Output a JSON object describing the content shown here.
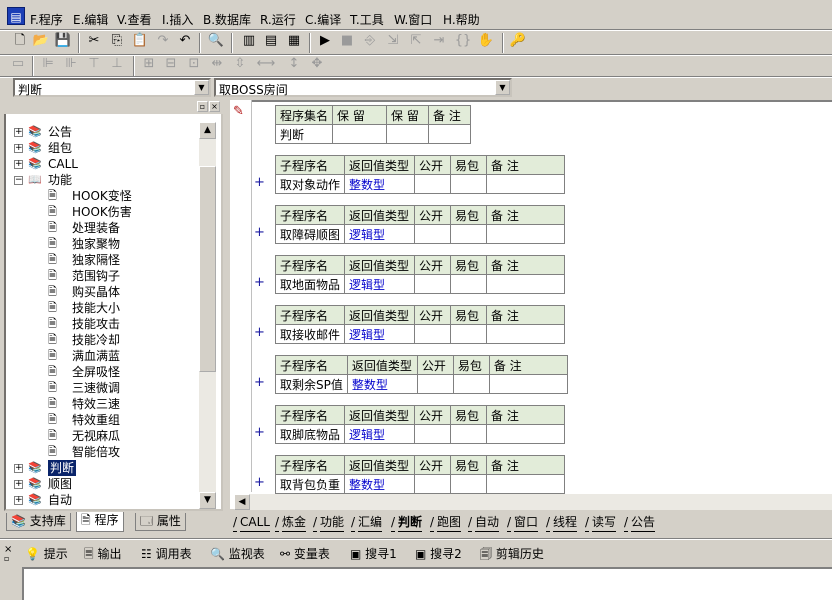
{
  "menu": [
    "F.程序",
    "E.编辑",
    "V.查看",
    "I.插入",
    "B.数据库",
    "R.运行",
    "C.编译",
    "T.工具",
    "W.窗口",
    "H.帮助"
  ],
  "icons": {
    "toolbar1": [
      "new-file-icon",
      "open-folder-icon",
      "save-icon",
      "cut-icon",
      "copy-icon",
      "paste-icon",
      "redo-icon",
      "undo-icon",
      "find-icon",
      "layout-icon",
      "layout2-icon",
      "layout3-icon",
      "run-icon",
      "stop-icon",
      "step-icons",
      "debug-icon"
    ],
    "toolbar2": [
      "align-icons"
    ]
  },
  "combos": {
    "left": "判断",
    "right": "取BOSS房间"
  },
  "tree": {
    "groups_before": [
      {
        "label": "公告",
        "expanded": false
      },
      {
        "label": "组包",
        "expanded": false
      },
      {
        "label": "CALL",
        "expanded": false
      },
      {
        "label": "功能",
        "expanded": true
      }
    ],
    "leaves": [
      "HOOK变怪",
      "HOOK伤害",
      "处理装备",
      "独家聚物",
      "独家隔怪",
      "范围钩子",
      "购买晶体",
      "技能大小",
      "技能攻击",
      "技能冷却",
      "满血满蓝",
      "全屏吸怪",
      "三速微调",
      "特效三速",
      "特效重组",
      "无视麻瓜",
      "智能倍攻"
    ],
    "groups_after": [
      {
        "label": "判断",
        "expanded": false,
        "selected": true
      },
      {
        "label": "顺图",
        "expanded": false
      },
      {
        "label": "自动",
        "expanded": false
      }
    ]
  },
  "left_tabs": [
    "支持库",
    "程序",
    "属性"
  ],
  "assembly": {
    "headers": [
      "程序集名",
      "保 留",
      "保 留",
      "备 注"
    ],
    "name": "判断"
  },
  "sub_headers": [
    "子程序名",
    "返回值类型",
    "公开",
    "易包",
    "备 注"
  ],
  "subs": [
    {
      "name": "取对象动作",
      "type": "整数型"
    },
    {
      "name": "取障碍顺图",
      "type": "逻辑型"
    },
    {
      "name": "取地面物品",
      "type": "逻辑型"
    },
    {
      "name": "取接收邮件",
      "type": "逻辑型"
    },
    {
      "name": "取剩余SP值",
      "type": "整数型"
    },
    {
      "name": "取脚底物品",
      "type": "逻辑型"
    },
    {
      "name": "取背包负重",
      "type": "整数型"
    }
  ],
  "editor_tabs": [
    "CALL",
    "炼金",
    "功能",
    "汇编",
    "判断",
    "跑图",
    "自动",
    "窗口",
    "线程",
    "读写",
    "公告"
  ],
  "active_editor_tab": "判断",
  "output_tabs": [
    "提示",
    "输出",
    "调用表",
    "监视表",
    "变量表",
    "搜寻1",
    "搜寻2",
    "剪辑历史"
  ]
}
